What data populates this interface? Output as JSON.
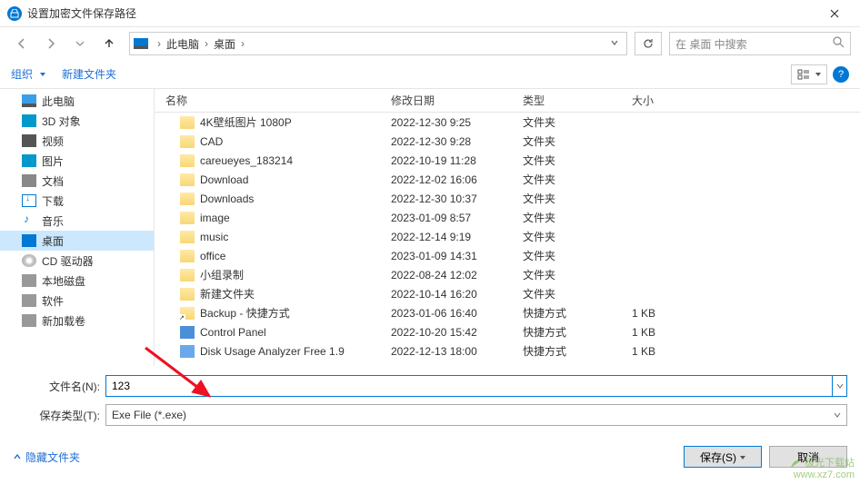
{
  "title": "设置加密文件保存路径",
  "path": {
    "root": "此电脑",
    "current": "桌面"
  },
  "search_placeholder": "在 桌面 中搜索",
  "toolbar": {
    "organize": "组织",
    "new_folder": "新建文件夹"
  },
  "sidebar": [
    {
      "label": "此电脑",
      "icon": "pc"
    },
    {
      "label": "3D 对象",
      "icon": "3d"
    },
    {
      "label": "视频",
      "icon": "video"
    },
    {
      "label": "图片",
      "icon": "pic"
    },
    {
      "label": "文档",
      "icon": "doc"
    },
    {
      "label": "下载",
      "icon": "dl"
    },
    {
      "label": "音乐",
      "icon": "music"
    },
    {
      "label": "桌面",
      "icon": "desktop",
      "selected": true
    },
    {
      "label": "CD 驱动器",
      "icon": "cd"
    },
    {
      "label": "本地磁盘",
      "icon": "disk"
    },
    {
      "label": "软件",
      "icon": "sw"
    },
    {
      "label": "新加载卷",
      "icon": "vol"
    }
  ],
  "columns": {
    "name": "名称",
    "date": "修改日期",
    "type": "类型",
    "size": "大小"
  },
  "files": [
    {
      "name": "4K壁纸图片 1080P",
      "date": "2022-12-30 9:25",
      "type": "文件夹",
      "size": "",
      "icon": "folder"
    },
    {
      "name": "CAD",
      "date": "2022-12-30 9:28",
      "type": "文件夹",
      "size": "",
      "icon": "folder"
    },
    {
      "name": "careueyes_183214",
      "date": "2022-10-19 11:28",
      "type": "文件夹",
      "size": "",
      "icon": "folder"
    },
    {
      "name": "Download",
      "date": "2022-12-02 16:06",
      "type": "文件夹",
      "size": "",
      "icon": "folder"
    },
    {
      "name": "Downloads",
      "date": "2022-12-30 10:37",
      "type": "文件夹",
      "size": "",
      "icon": "folder"
    },
    {
      "name": "image",
      "date": "2023-01-09 8:57",
      "type": "文件夹",
      "size": "",
      "icon": "folder"
    },
    {
      "name": "music",
      "date": "2022-12-14 9:19",
      "type": "文件夹",
      "size": "",
      "icon": "folder"
    },
    {
      "name": "office",
      "date": "2023-01-09 14:31",
      "type": "文件夹",
      "size": "",
      "icon": "folder"
    },
    {
      "name": "小组录制",
      "date": "2022-08-24 12:02",
      "type": "文件夹",
      "size": "",
      "icon": "folder"
    },
    {
      "name": "新建文件夹",
      "date": "2022-10-14 16:20",
      "type": "文件夹",
      "size": "",
      "icon": "folder"
    },
    {
      "name": "Backup - 快捷方式",
      "date": "2023-01-06 16:40",
      "type": "快捷方式",
      "size": "1 KB",
      "icon": "shortcut"
    },
    {
      "name": "Control Panel",
      "date": "2022-10-20 15:42",
      "type": "快捷方式",
      "size": "1 KB",
      "icon": "cp"
    },
    {
      "name": "Disk Usage Analyzer Free 1.9",
      "date": "2022-12-13 18:00",
      "type": "快捷方式",
      "size": "1 KB",
      "icon": "app"
    }
  ],
  "form": {
    "filename_label": "文件名(N):",
    "filename_value": "123",
    "savetype_label": "保存类型(T):",
    "savetype_value": "Exe File (*.exe)"
  },
  "footer": {
    "hide_folders": "隐藏文件夹",
    "save": "保存(S)",
    "cancel": "取消"
  },
  "watermark": {
    "line1": "极光下载站",
    "line2": "www.xz7.com"
  }
}
